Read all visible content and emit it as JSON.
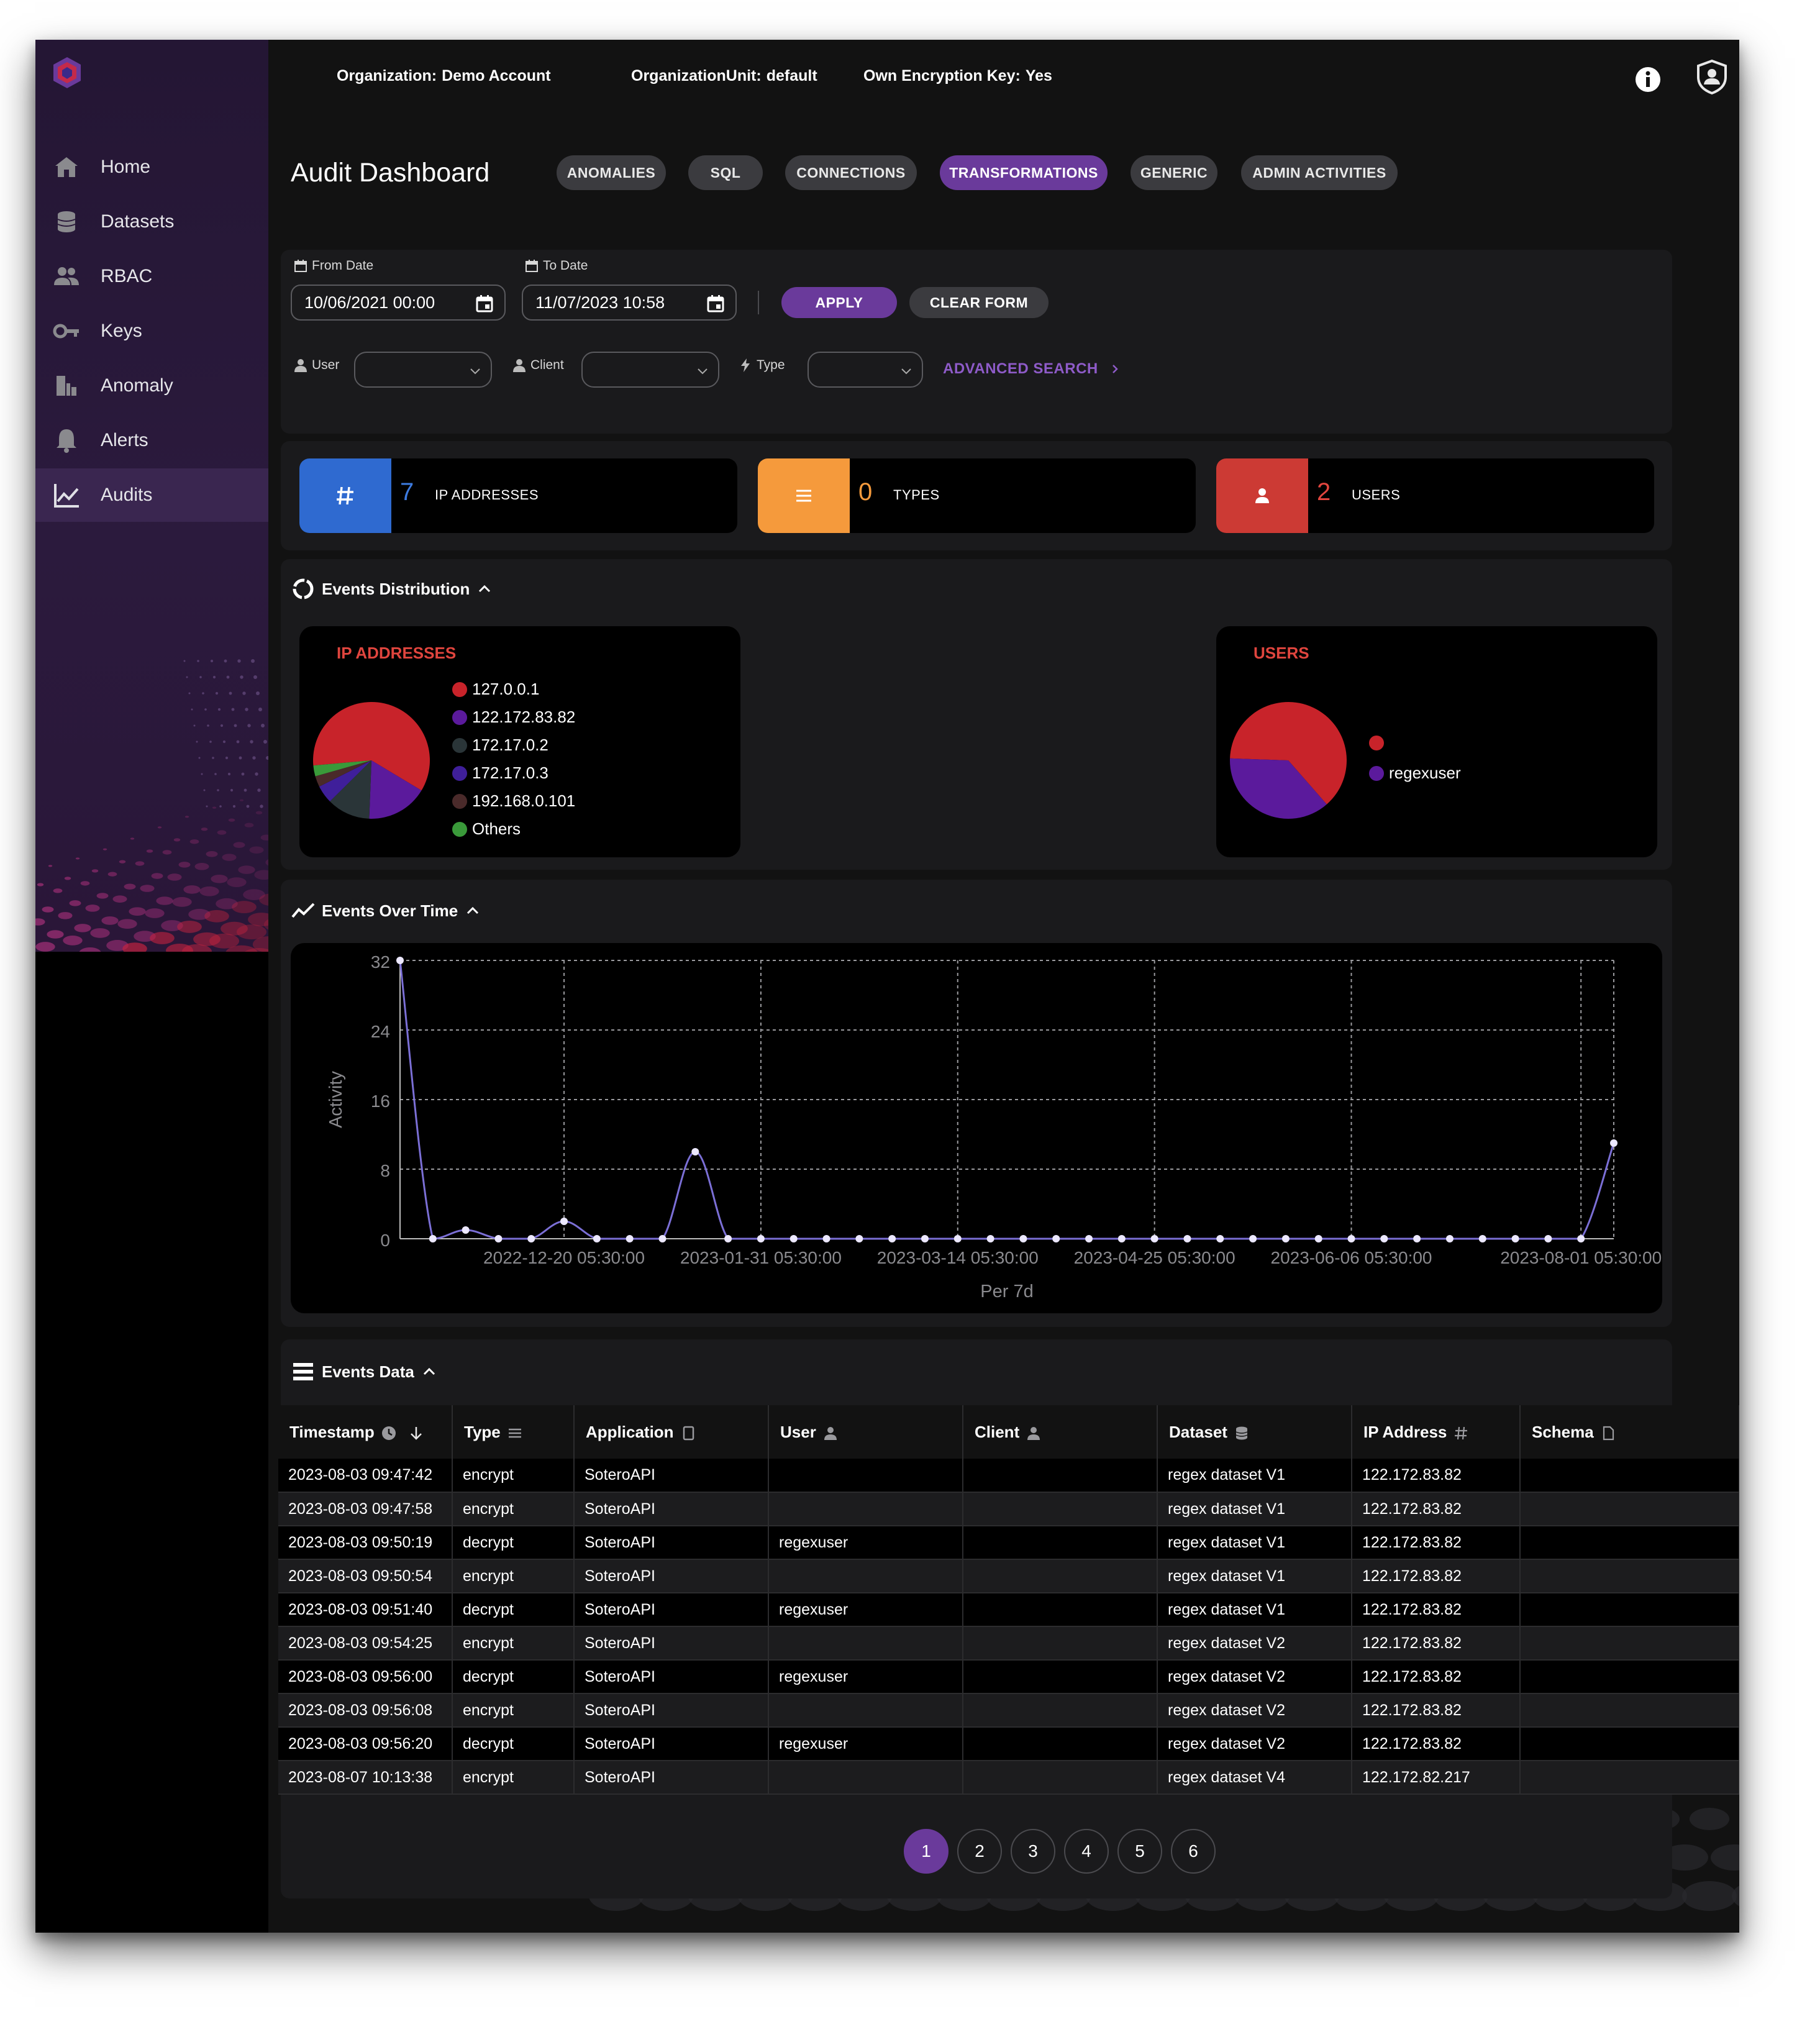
{
  "header": {
    "organization_label": "Organization:",
    "organization_value": "Demo Account",
    "org_unit_label": "OrganizationUnit:",
    "org_unit_value": "default",
    "encryption_label": "Own Encryption Key:",
    "encryption_value": "Yes",
    "icons": [
      "info-icon",
      "profile-shield-icon"
    ]
  },
  "sidebar": {
    "items": [
      {
        "label": "Home",
        "icon": "home-icon"
      },
      {
        "label": "Datasets",
        "icon": "database-icon"
      },
      {
        "label": "RBAC",
        "icon": "people-icon"
      },
      {
        "label": "Keys",
        "icon": "key-icon"
      },
      {
        "label": "Anomaly",
        "icon": "anomaly-icon"
      },
      {
        "label": "Alerts",
        "icon": "bell-icon"
      },
      {
        "label": "Audits",
        "icon": "chart-line-icon"
      }
    ],
    "active": "Audits"
  },
  "page": {
    "title": "Audit Dashboard",
    "tabs": [
      "ANOMALIES",
      "SQL",
      "CONNECTIONS",
      "TRANSFORMATIONS",
      "GENERIC",
      "ADMIN ACTIVITIES"
    ],
    "active_tab": "TRANSFORMATIONS"
  },
  "filters": {
    "from_label": "From Date",
    "from_value": "10/06/2021 00:00",
    "to_label": "To Date",
    "to_value": "11/07/2023 10:58",
    "apply_label": "APPLY",
    "clear_label": "CLEAR FORM",
    "user_label": "User",
    "client_label": "Client",
    "type_label": "Type",
    "advanced_label": "ADVANCED SEARCH"
  },
  "stats": [
    {
      "number": "7",
      "label": "IP ADDRESSES",
      "icon": "hash-icon",
      "color": "#2f6ad0"
    },
    {
      "number": "0",
      "label": "TYPES",
      "icon": "list-icon",
      "color": "#f59a3c"
    },
    {
      "number": "2",
      "label": "USERS",
      "icon": "person-icon",
      "color": "#cc3a34"
    }
  ],
  "distribution": {
    "title": "Events Distribution",
    "ip_card": {
      "title": "IP ADDRESSES",
      "legend": [
        {
          "label": "127.0.0.1",
          "color": "#c8232a"
        },
        {
          "label": "122.172.83.82",
          "color": "#5b1a9c"
        },
        {
          "label": "172.17.0.2",
          "color": "#2a3538"
        },
        {
          "label": "172.17.0.3",
          "color": "#3f1f9a"
        },
        {
          "label": "192.168.0.101",
          "color": "#4a2a2a"
        },
        {
          "label": "Others",
          "color": "#3a9a3a"
        }
      ]
    },
    "users_card": {
      "title": "USERS",
      "legend": [
        {
          "label": "",
          "color": "#c8232a"
        },
        {
          "label": "regexuser",
          "color": "#5b1a9c"
        }
      ]
    }
  },
  "over_time": {
    "title": "Events Over Time"
  },
  "chart_data": [
    {
      "type": "pie",
      "title": "IP ADDRESSES",
      "labels": [
        "127.0.0.1",
        "122.172.83.82",
        "172.17.0.2",
        "172.17.0.3",
        "192.168.0.101",
        "Others"
      ],
      "values": [
        60,
        17,
        12,
        5,
        3,
        3
      ],
      "colors": [
        "#c8232a",
        "#5b1a9c",
        "#2a3538",
        "#3f1f9a",
        "#4a2a2a",
        "#3a9a3a"
      ]
    },
    {
      "type": "pie",
      "title": "USERS",
      "labels": [
        "",
        "regexuser"
      ],
      "values": [
        63,
        37
      ],
      "colors": [
        "#c8232a",
        "#5b1a9c"
      ]
    },
    {
      "type": "line",
      "title": "",
      "xlabel": "Per 7d",
      "ylabel": "Activity",
      "ylim": [
        0,
        32
      ],
      "yticks": [
        0,
        8,
        16,
        24,
        32
      ],
      "xtick_labels": [
        "2022-12-20 05:30:00",
        "2023-01-31 05:30:00",
        "2023-03-14 05:30:00",
        "2023-04-25 05:30:00",
        "2023-06-06 05:30:00",
        "2023-08-01 05:30:00"
      ],
      "xtick_index": [
        5,
        11,
        17,
        23,
        29,
        36
      ],
      "grid": true,
      "color": "#7b6fd6",
      "values": [
        32,
        0,
        1,
        0,
        0,
        2,
        0,
        0,
        0,
        10,
        0,
        0,
        0,
        0,
        0,
        0,
        0,
        0,
        0,
        0,
        0,
        0,
        0,
        0,
        0,
        0,
        0,
        0,
        0,
        0,
        0,
        0,
        0,
        0,
        0,
        0,
        0,
        11
      ]
    }
  ],
  "events": {
    "title": "Events Data",
    "columns": [
      {
        "label": "Timestamp",
        "icon": "clock-icon"
      },
      {
        "label": "Type",
        "icon": "list-icon"
      },
      {
        "label": "Application",
        "icon": "tablet-icon"
      },
      {
        "label": "User",
        "icon": "person-icon"
      },
      {
        "label": "Client",
        "icon": "person-icon"
      },
      {
        "label": "Dataset",
        "icon": "database-icon"
      },
      {
        "label": "IP Address",
        "icon": "hash-icon"
      },
      {
        "label": "Schema",
        "icon": "file-icon"
      }
    ],
    "rows": [
      [
        "2023-08-03 09:47:42",
        "encrypt",
        "SoteroAPI",
        "",
        "",
        "regex dataset V1",
        "122.172.83.82",
        ""
      ],
      [
        "2023-08-03 09:47:58",
        "encrypt",
        "SoteroAPI",
        "",
        "",
        "regex dataset V1",
        "122.172.83.82",
        ""
      ],
      [
        "2023-08-03 09:50:19",
        "decrypt",
        "SoteroAPI",
        "regexuser",
        "",
        "regex dataset V1",
        "122.172.83.82",
        ""
      ],
      [
        "2023-08-03 09:50:54",
        "encrypt",
        "SoteroAPI",
        "",
        "",
        "regex dataset V1",
        "122.172.83.82",
        ""
      ],
      [
        "2023-08-03 09:51:40",
        "decrypt",
        "SoteroAPI",
        "regexuser",
        "",
        "regex dataset V1",
        "122.172.83.82",
        ""
      ],
      [
        "2023-08-03 09:54:25",
        "encrypt",
        "SoteroAPI",
        "",
        "",
        "regex dataset V2",
        "122.172.83.82",
        ""
      ],
      [
        "2023-08-03 09:56:00",
        "decrypt",
        "SoteroAPI",
        "regexuser",
        "",
        "regex dataset V2",
        "122.172.83.82",
        ""
      ],
      [
        "2023-08-03 09:56:08",
        "encrypt",
        "SoteroAPI",
        "",
        "",
        "regex dataset V2",
        "122.172.83.82",
        ""
      ],
      [
        "2023-08-03 09:56:20",
        "decrypt",
        "SoteroAPI",
        "regexuser",
        "",
        "regex dataset V2",
        "122.172.83.82",
        ""
      ],
      [
        "2023-08-07 10:13:38",
        "encrypt",
        "SoteroAPI",
        "",
        "",
        "regex dataset V4",
        "122.172.82.217",
        ""
      ]
    ]
  },
  "pagination": {
    "pages": [
      "1",
      "2",
      "3",
      "4",
      "5",
      "6"
    ],
    "current": "1"
  }
}
